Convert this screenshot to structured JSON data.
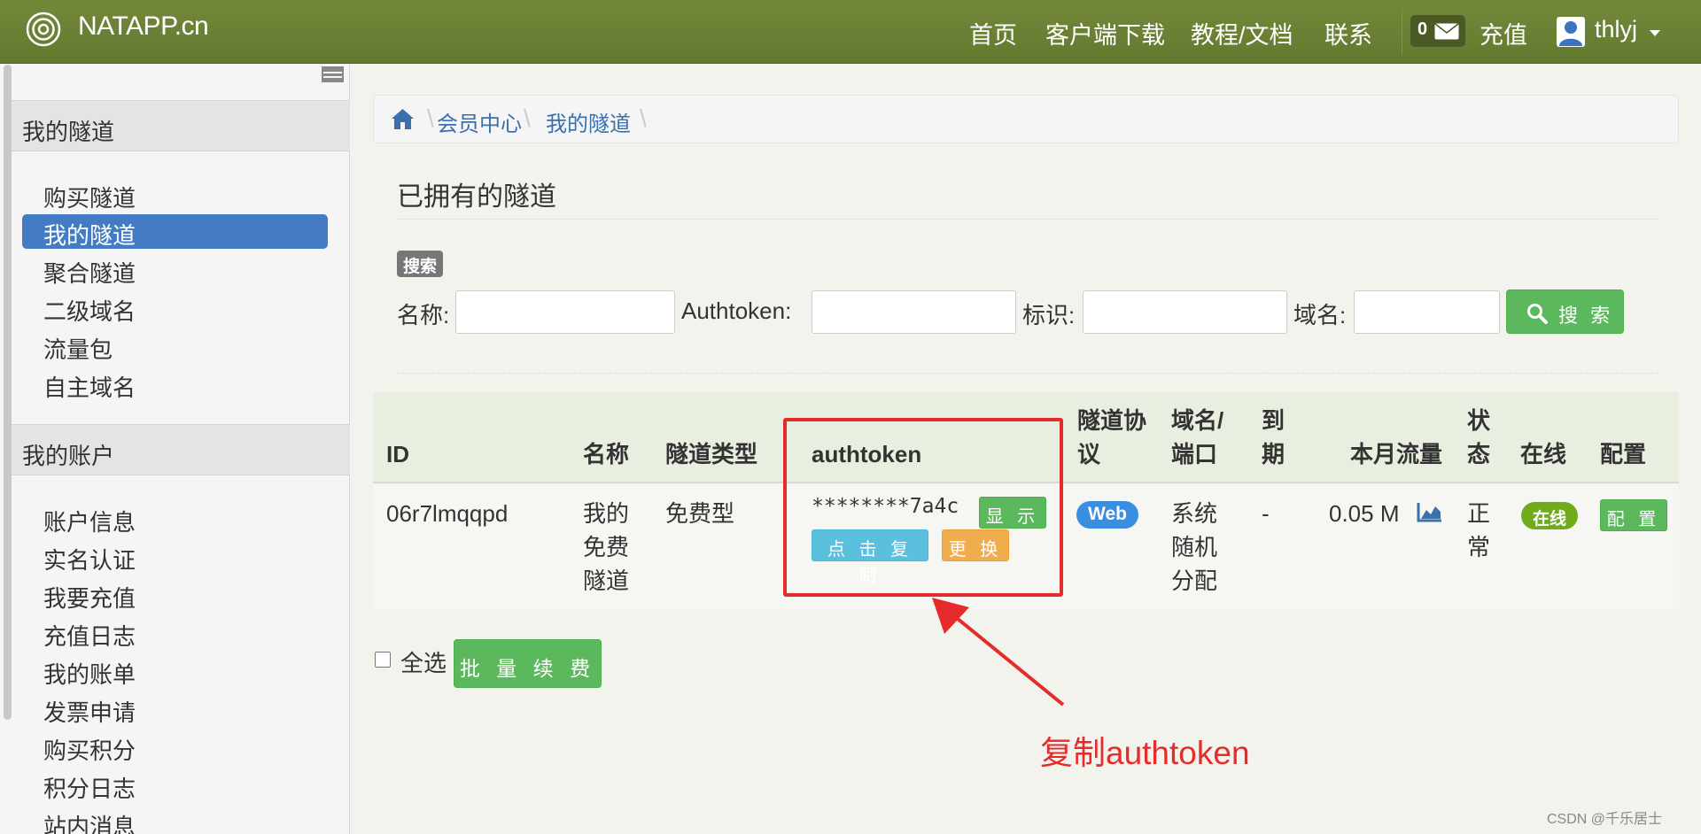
{
  "navbar": {
    "brand": "NATAPP.cn",
    "links": [
      "首页",
      "客户端下载",
      "教程/文档",
      "联系"
    ],
    "message_count": "0",
    "recharge": "充值",
    "username": "thlyj"
  },
  "sidebar": {
    "sections": [
      {
        "title": "我的隧道",
        "items": [
          "购买隧道",
          "我的隧道",
          "聚合隧道",
          "二级域名",
          "流量包",
          "自主域名"
        ]
      },
      {
        "title": "我的账户",
        "items": [
          "账户信息",
          "实名认证",
          "我要充值",
          "充值日志",
          "我的账单",
          "发票申请",
          "购买积分",
          "积分日志",
          "站内消息"
        ]
      }
    ],
    "active_item": "我的隧道"
  },
  "breadcrumb": [
    "会员中心",
    "我的隧道"
  ],
  "page_title": "已拥有的隧道",
  "search": {
    "badge": "搜索",
    "fields": [
      {
        "label": "名称:",
        "value": ""
      },
      {
        "label": "Authtoken:",
        "value": ""
      },
      {
        "label": "标识:",
        "value": ""
      },
      {
        "label": "域名:",
        "value": ""
      }
    ],
    "button": "搜 索"
  },
  "table": {
    "headers": {
      "id": "ID",
      "name": "名称",
      "type": "隧道类型",
      "authtoken": "authtoken",
      "protocol": [
        "隧道协",
        "议"
      ],
      "domain": [
        "域名/",
        "端口"
      ],
      "expire": [
        "到",
        "期"
      ],
      "traffic": "本月流量",
      "status": [
        "状",
        "态"
      ],
      "online": "在线",
      "config": "配置"
    },
    "rows": [
      {
        "id": "06r7lmqqpd",
        "name": [
          "我的",
          "免费",
          "隧道"
        ],
        "type": "免费型",
        "authtoken_masked": "********7a4c",
        "show_button": "显 示",
        "copy_button": "点 击 复 制",
        "change_button": "更 换",
        "protocol": "Web",
        "domain": [
          "系统",
          "随机",
          "分配"
        ],
        "expire": "-",
        "traffic": "0.05 M",
        "status": [
          "正",
          "常"
        ],
        "online": "在线",
        "config_button": "配 置"
      }
    ]
  },
  "footer": {
    "select_all": "全选",
    "renew_button": "批 量 续 费"
  },
  "annotation": "复制authtoken",
  "watermark": "CSDN @千乐居士",
  "colors": {
    "navbar": "#6a7f34",
    "active": "#437bc4",
    "green": "#5cb85c",
    "info": "#5bc0de",
    "warning": "#f0ad4e",
    "annotation_red": "#e52b2b"
  }
}
